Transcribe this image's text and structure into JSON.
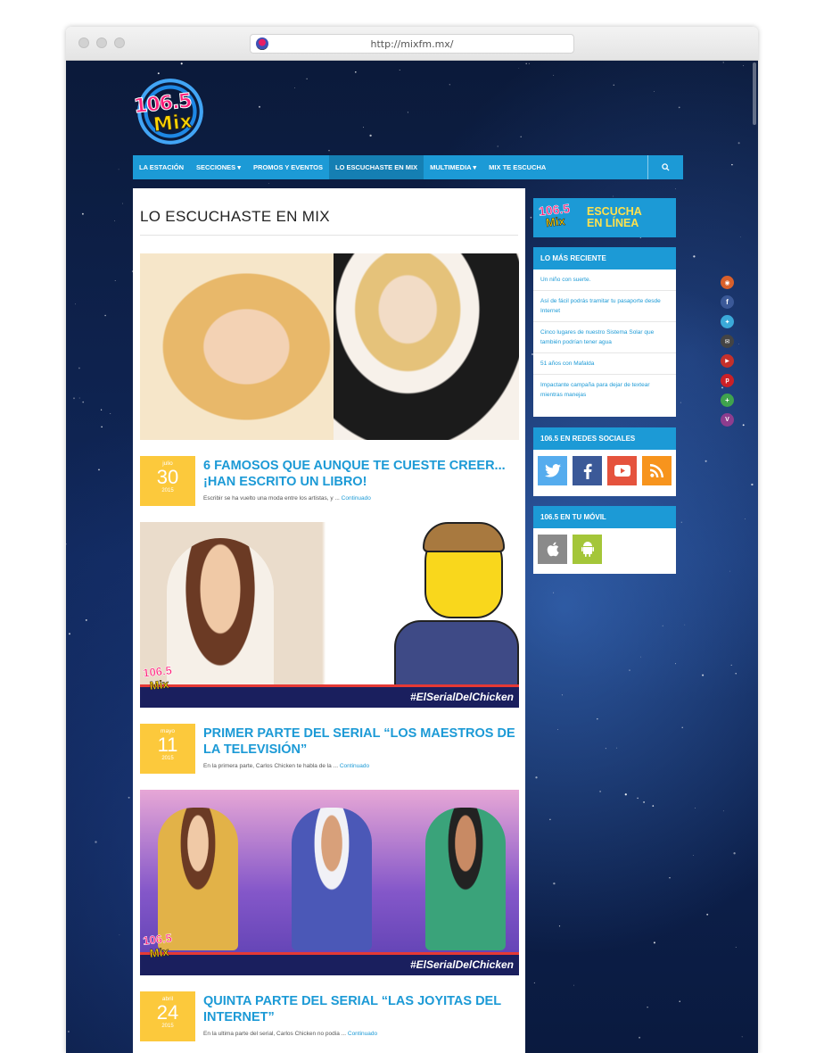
{
  "browser": {
    "url": "http://mixfm.mx/"
  },
  "logo": {
    "number": "106.5",
    "word": "Mix"
  },
  "nav": {
    "items": [
      "LA ESTACIÓN",
      "SECCIONES ▾",
      "PROMOS Y EVENTOS",
      "LO ESCUCHASTE EN MIX",
      "MULTIMEDIA ▾",
      "MIX TE ESCUCHA"
    ],
    "active_index": 3
  },
  "main": {
    "page_title": "LO ESCUCHASTE EN MIX",
    "banner_tag": "#ElSerialDelChicken",
    "posts": [
      {
        "month": "julio",
        "day": "30",
        "year": "2015",
        "title": "6 FAMOSOS QUE AUNQUE TE CUESTE CREER... ¡HAN ESCRITO UN LIBRO!",
        "excerpt": "Escribir se ha vuelto una moda entre los artistas, y ...",
        "more": "Continuado"
      },
      {
        "month": "mayo",
        "day": "11",
        "year": "2015",
        "title": "PRIMER PARTE DEL SERIAL “LOS MAESTROS DE LA TELEVISIÓN”",
        "excerpt": "En la primera parte, Carlos Chicken te habla de la ...",
        "more": "Continuado"
      },
      {
        "month": "abril",
        "day": "24",
        "year": "2015",
        "title": "QUINTA PARTE DEL SERIAL “LAS JOYITAS DEL INTERNET”",
        "excerpt": "En la ultima parte del serial, Carlos Chicken no podia ...",
        "more": "Continuado"
      }
    ]
  },
  "sidebar": {
    "escucha": {
      "logo_number": "106.5",
      "logo_word": "Mix",
      "line1": "ESCUCHA",
      "line2": "EN LÍNEA"
    },
    "recent": {
      "title": "LO MÁS RECIENTE",
      "items": [
        "Un niño con suerte.",
        "Así de fácil podrás tramitar tu pasaporte desde Internet",
        "Cinco lugares de nuestro Sistema Solar que también podrían tener agua",
        "51 años con Mafalda",
        "Impactante campaña para dejar de textear mientras manejas"
      ]
    },
    "social": {
      "title": "106.5 EN REDES SOCIALES",
      "icons": [
        {
          "name": "twitter-icon",
          "color": "#55acee"
        },
        {
          "name": "facebook-icon",
          "color": "#3b5998"
        },
        {
          "name": "youtube-icon",
          "color": "#e5533d"
        },
        {
          "name": "rss-icon",
          "color": "#f7941d"
        }
      ]
    },
    "mobile": {
      "title": "106.5 EN TU MÓVIL",
      "icons": [
        {
          "name": "apple-icon",
          "color": "#8a8a8a"
        },
        {
          "name": "android-icon",
          "color": "#a4c639"
        }
      ]
    }
  },
  "share_bar": {
    "icons": [
      {
        "name": "rss-share-icon",
        "color": "#d9602b"
      },
      {
        "name": "facebook-share-icon",
        "color": "#3b5998"
      },
      {
        "name": "twitter-share-icon",
        "color": "#3ba9d9"
      },
      {
        "name": "email-share-icon",
        "color": "#444444"
      },
      {
        "name": "youtube-share-icon",
        "color": "#c4302b"
      },
      {
        "name": "pinterest-share-icon",
        "color": "#cb2027"
      },
      {
        "name": "googleplus-share-icon",
        "color": "#3fa34d"
      },
      {
        "name": "vine-share-icon",
        "color": "#8e3d8e"
      }
    ]
  },
  "colors": {
    "accent": "#1c9ad6",
    "date_box": "#fcc93c"
  }
}
